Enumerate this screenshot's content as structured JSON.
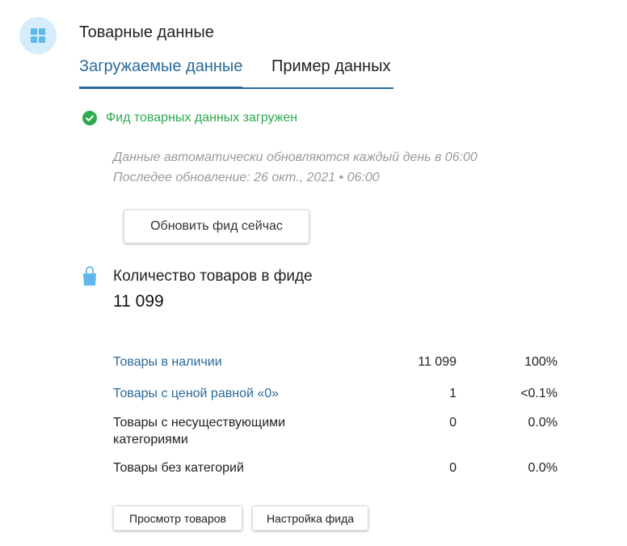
{
  "section": {
    "title": "Товарные данные",
    "icon": "grid-icon"
  },
  "tabs": [
    {
      "label": "Загружаемые данные",
      "active": true
    },
    {
      "label": "Пример данных",
      "active": false
    }
  ],
  "status": {
    "text": "Фид товарных данных загружен",
    "icon": "check-circle-icon",
    "color": "#2eaa4f"
  },
  "info": {
    "line1": "Данные автоматически обновляются каждый день в 06:00",
    "line2": "Последее обновление: 26 окт., 2021 • 06:00"
  },
  "refresh_button": "Обновить фид сейчас",
  "products": {
    "icon": "shopping-bag-icon",
    "label": "Количество товаров в фиде",
    "count": "11 099"
  },
  "stats": [
    {
      "label": "Товары в наличии",
      "count": "11 099",
      "percent": "100%",
      "link": true
    },
    {
      "label": "Товары с ценой равной «0»",
      "count": "1",
      "percent": "<0.1%",
      "link": true
    },
    {
      "label": "Товары с несуществующими категориями",
      "count": "0",
      "percent": "0.0%",
      "link": false
    },
    {
      "label": "Товары без категорий",
      "count": "0",
      "percent": "0.0%",
      "link": false
    }
  ],
  "buttons": {
    "view": "Просмотр товаров",
    "settings": "Настройка фида"
  },
  "colors": {
    "accent": "#2a6a9a",
    "icon_bg": "#d4ecfb",
    "icon_fg": "#5fb8ec",
    "success": "#2eaa4f",
    "muted": "#9a9a9a"
  }
}
